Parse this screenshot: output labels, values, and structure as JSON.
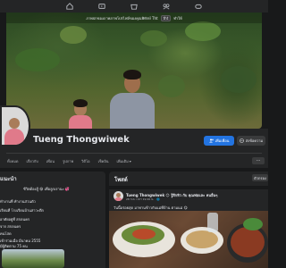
{
  "top_nav": {
    "items": [
      "home-icon",
      "video-icon",
      "marketplace-icon",
      "groups-icon",
      "gaming-icon"
    ]
  },
  "cover": {
    "caption": "ภาพปกของภาพภาพโปรไฟล์ของคุณพิทักษ์ Tht",
    "tag_label": "tht",
    "tail": "ทำให้"
  },
  "profile": {
    "name": "Tueng Thongwiwek",
    "add_friend_label": "เพิ่มเพื่อน",
    "message_label": "ส่งข้อความ"
  },
  "tabs": {
    "items": [
      "ทั้งหมด",
      "เกี่ยวกับ",
      "เพื่อน",
      "รูปภาพ",
      "วิดีโอ",
      "เช็คอิน",
      "เพิ่มเติม"
    ],
    "more_icon": "▾",
    "dots_icon": "···"
  },
  "intro": {
    "title": "แนะนำ",
    "bio": "ชีวิตต้องสู้ 😁 เพื่อลูกเรานะ 💞",
    "lines": [
      "ทำงานที่ ทำงานส่วนตัว",
      "เรียนที่ โรงเรียนบ้านสาวะตึก",
      "อาศัยอยู่ที่ สกลนคร",
      "จาก สกลนคร",
      "คนโสด",
      "เข้าร่วมเมื่อ มีนาคม 2555",
      "มีผู้ติดตาม 75 คน"
    ]
  },
  "posts": {
    "header": "โพสต์",
    "filter_label": "ตัวกรอง",
    "items": [
      {
        "author": "Tueng Thongwiwek 😊 รู้สึกหิว กับ คุณพ่อและ คนอื่นๆ",
        "meta": "28 ก.ค. เวลา 19:00 น. · 🌐",
        "text": "วันนี้อร่อยสุด มาทานข้าวกับแม่ที่บ้าน ตามแม่ 😋"
      }
    ]
  },
  "colors": {
    "background": "#18191a",
    "surface": "#242526",
    "accent": "#2374e1",
    "text_primary": "#e4e6eb",
    "text_secondary": "#b0b3b8"
  }
}
